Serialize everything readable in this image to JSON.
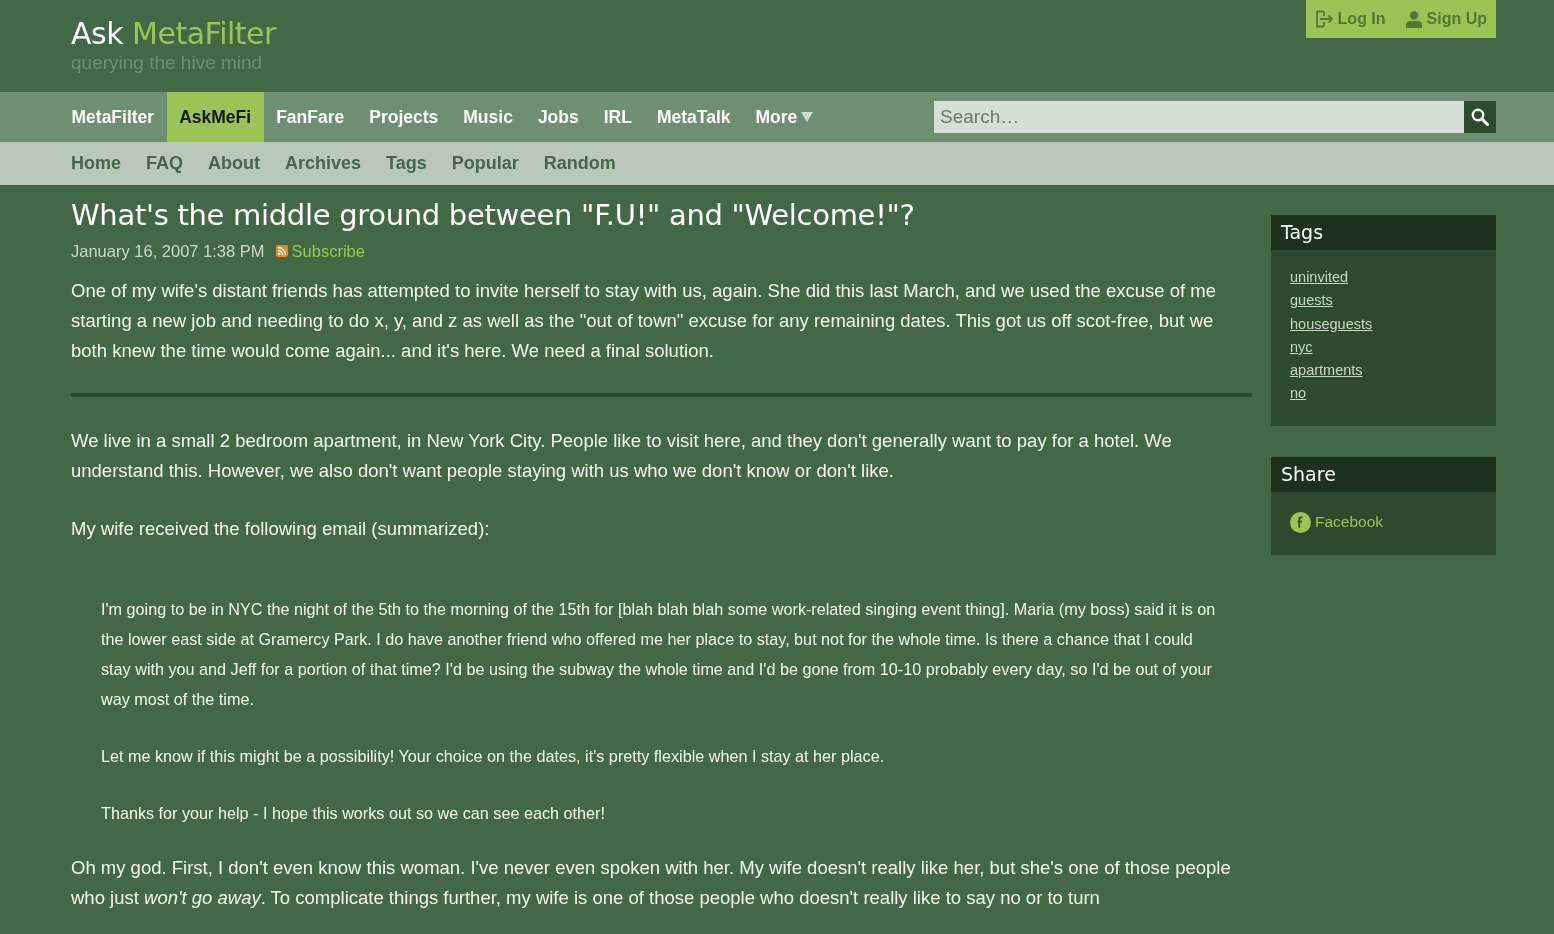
{
  "header": {
    "logo": {
      "part_1": "Ask",
      "part_2": "MetaFilter"
    },
    "tagline": "querying the hive mind"
  },
  "account": [
    {
      "label": "Log In",
      "kind": "login"
    },
    {
      "label": "Sign Up",
      "kind": "signup"
    }
  ],
  "nav": {
    "items": [
      {
        "label": "MetaFilter",
        "selected": false,
        "kind": "link"
      },
      {
        "label": "AskMeFi",
        "selected": true,
        "kind": "link"
      },
      {
        "label": "FanFare",
        "selected": false,
        "kind": "link"
      },
      {
        "label": "Projects",
        "selected": false,
        "kind": "link"
      },
      {
        "label": "Music",
        "selected": false,
        "kind": "link"
      },
      {
        "label": "Jobs",
        "selected": false,
        "kind": "link"
      },
      {
        "label": "IRL",
        "selected": false,
        "kind": "link"
      },
      {
        "label": "MetaTalk",
        "selected": false,
        "kind": "link"
      },
      {
        "label": "More",
        "selected": false,
        "kind": "dropdown"
      }
    ],
    "search": {
      "placeholder": "Search…"
    }
  },
  "subnav": [
    "Home",
    "FAQ",
    "About",
    "Archives",
    "Tags",
    "Popular",
    "Random"
  ],
  "post": {
    "title": "What's the middle ground between \"F.U!\" and \"Welcome!\"?",
    "date": "January 16, 2007 1:38 PM",
    "subscribe": "Subscribe",
    "summary": "One of my wife's distant friends has attempted to invite herself to stay with us, again. She did this last March, and we used the excuse of me starting a new job and needing to do x, y, and z as well as the \"out of town\" excuse for any remaining dates. This got us off scot-free, but we both knew the time would come again... and it's here. We need a final solution.",
    "body": [
      {
        "kind": "paragraph",
        "text": "We live in a small 2 bedroom apartment, in New York City. People like to visit here, and they don't generally want to pay for a hotel. We understand this. However, we also don't want people staying with us who we don't know or don't like."
      },
      {
        "kind": "paragraph",
        "text": "My wife received the following email (summarized):"
      },
      {
        "kind": "quote",
        "paragraphs": [
          "I'm going to be in NYC the night of the 5th to the morning of the 15th for [blah blah blah some work-related singing event thing]. Maria (my boss) said it is on the lower east side at Gramercy Park. I do have another friend who offered me her place to stay, but not for the whole time. Is there a chance that I could stay with you and Jeff for a portion of that time? I'd be using the subway the whole time and I'd be gone from 10-10 probably every day, so I'd be out of your way most of the time.",
          "Let me know if this might be a possibility! Your choice on the dates, it's pretty flexible when I stay at her place.",
          "Thanks for your help - I hope this works out so we can see each other!"
        ]
      },
      {
        "kind": "paragraph",
        "text": "Oh my god. First, I don't even know this woman. I've never even spoken with her. My wife doesn't really like her, but she's one of those people who just *won't go away*. To complicate things further, my wife is one of those people who doesn't really like to say no or to turn"
      }
    ]
  },
  "sidebar": [
    {
      "title": "Tags",
      "kind": "tags",
      "items": [
        "uninvited",
        "guests",
        "houseguests",
        "nyc",
        "apartments",
        "no"
      ]
    },
    {
      "title": "Share",
      "kind": "share",
      "items": [
        "Facebook"
      ]
    }
  ]
}
